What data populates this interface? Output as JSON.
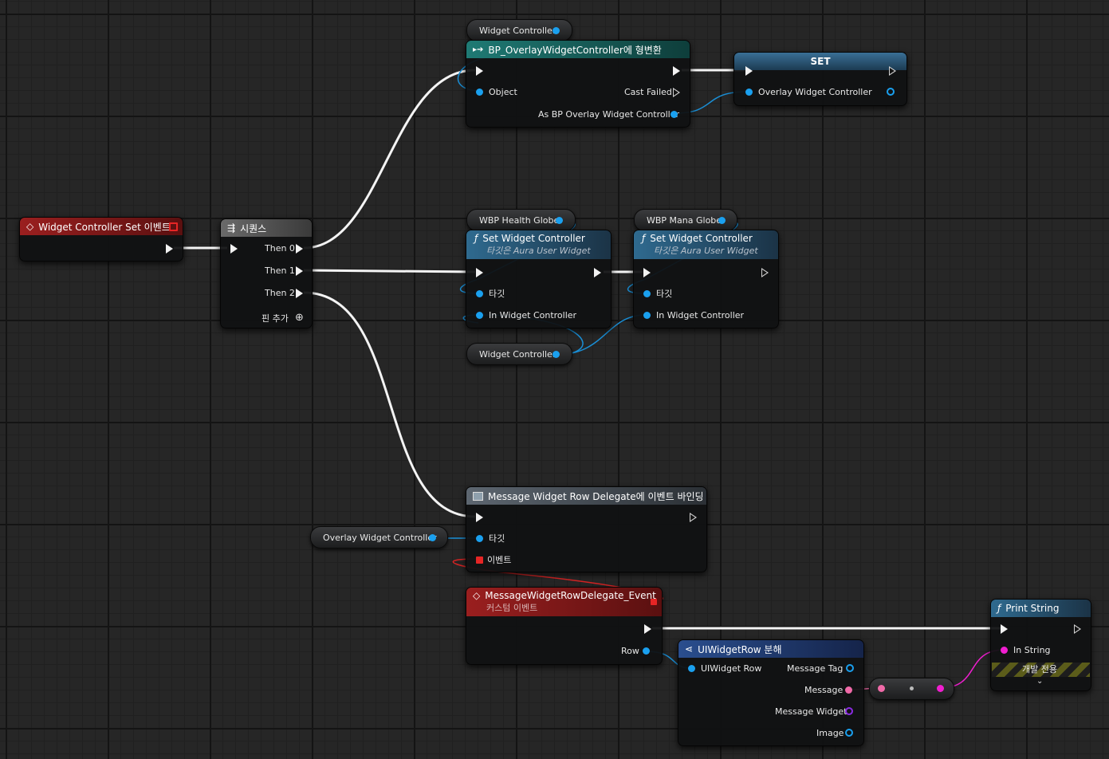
{
  "nodes": {
    "event_widget_controller_set": {
      "title": "Widget Controller Set 이벤트"
    },
    "sequence": {
      "title": "시퀀스",
      "then0": "Then 0",
      "then1": "Then 1",
      "then2": "Then 2",
      "add_pin": "핀 추가"
    },
    "cast": {
      "title": "BP_OverlayWidgetController에 형변환",
      "object": "Object",
      "cast_failed": "Cast Failed",
      "as_output": "As BP Overlay Widget Controller"
    },
    "set_var": {
      "title": "SET",
      "var": "Overlay Widget Controller"
    },
    "var_widget_controller_top": {
      "label": "Widget Controller"
    },
    "var_wbp_health": {
      "label": "WBP Health Globe"
    },
    "var_wbp_mana": {
      "label": "WBP Mana Globe"
    },
    "var_widget_controller_mid": {
      "label": "Widget Controller"
    },
    "set_wc_health": {
      "title": "Set Widget Controller",
      "subtitle": "타깃은 Aura User Widget",
      "target": "타깃",
      "in_wc": "In Widget Controller"
    },
    "set_wc_mana": {
      "title": "Set Widget Controller",
      "subtitle": "타깃은 Aura User Widget",
      "target": "타깃",
      "in_wc": "In Widget Controller"
    },
    "bind_event": {
      "title": "Message Widget Row Delegate에 이벤트 바인딩",
      "target": "타깃",
      "event": "이벤트"
    },
    "var_overlay_wc": {
      "label": "Overlay Widget Controller"
    },
    "custom_event": {
      "title": "MessageWidgetRowDelegate_Event",
      "subtitle": "커스텀 이벤트",
      "row": "Row"
    },
    "break_struct": {
      "title": "UIWidgetRow 분해",
      "in": "UIWidget Row",
      "message_tag": "Message Tag",
      "message": "Message",
      "message_widget": "Message Widget",
      "image": "Image"
    },
    "print_string": {
      "title": "Print String",
      "in_string": "In String",
      "dev_only": "개발 전용"
    }
  },
  "colors": {
    "event_header": "#8e1c1c",
    "cast_header": "#1b6e6a",
    "function_header": "#2e5f82",
    "sequence_header": "#5a5a5a",
    "set_header": "#2e5f82",
    "struct_header": "#1e3d7a",
    "object_pin": "#1aa0ef",
    "string_pin": "#f01ed0",
    "text_pin": "#f06aa8",
    "delegate_pin": "#e62525",
    "exec_wire": "#f2f2f2"
  }
}
